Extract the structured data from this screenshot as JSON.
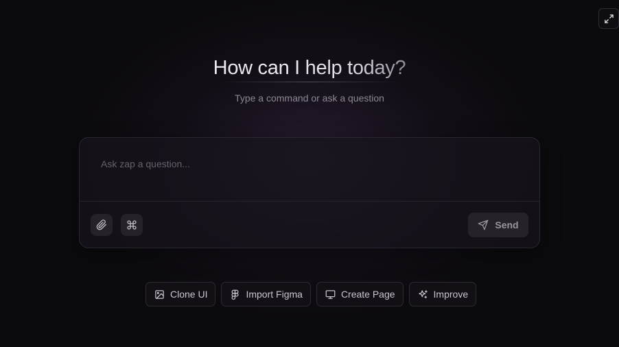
{
  "header": {
    "expand_icon": "expand-arrows-icon"
  },
  "hero": {
    "title_plain": "How can I ",
    "title_gradient": "help today?",
    "subtitle": "Type a command or ask a question"
  },
  "composer": {
    "placeholder": "Ask zap a question...",
    "value": "",
    "attach_icon": "paperclip-icon",
    "command_icon": "command-icon",
    "send_label": "Send",
    "send_icon": "send-icon"
  },
  "quick_actions": [
    {
      "label": "Clone UI",
      "icon": "image-icon"
    },
    {
      "label": "Import Figma",
      "icon": "figma-icon"
    },
    {
      "label": "Create Page",
      "icon": "monitor-icon"
    },
    {
      "label": "Improve",
      "icon": "sparkles-icon"
    }
  ],
  "colors": {
    "background": "#0b0a0d",
    "panel": "#18141c",
    "button": "#25222a",
    "text_primary": "#ece9ef",
    "text_muted": "#8c8893"
  }
}
